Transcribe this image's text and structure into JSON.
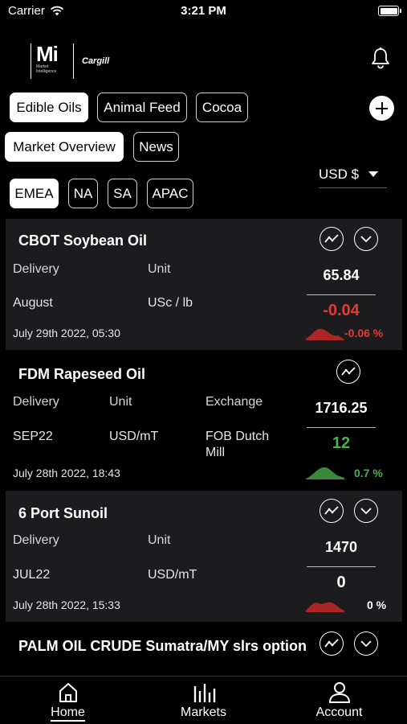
{
  "status_bar": {
    "carrier": "Carrier",
    "time": "3:21 PM"
  },
  "brand": {
    "mi": "Mi",
    "mi_sub_1": "Market",
    "mi_sub_2": "Intelligence",
    "partner": "Cargill"
  },
  "categories": [
    "Edible Oils",
    "Animal Feed",
    "Cocoa"
  ],
  "views": [
    "Market Overview",
    "News"
  ],
  "regions": [
    "EMEA",
    "NA",
    "SA",
    "APAC"
  ],
  "currency": "USD $",
  "products": [
    {
      "name": "CBOT Soybean Oil",
      "delivery_label": "Delivery",
      "unit_label": "Unit",
      "delivery": "August",
      "unit": "USc / lb",
      "date": "July 29th 2022, 05:30",
      "price": "65.84",
      "change": "-0.04",
      "change_pct": "-0.06 %"
    },
    {
      "name": "FDM Rapeseed Oil",
      "delivery_label": "Delivery",
      "unit_label": "Unit",
      "exchange_label": "Exchange",
      "delivery": "SEP22",
      "unit": "USD/mT",
      "exchange": "FOB Dutch Mill",
      "date": "July 28th 2022, 18:43",
      "price": "1716.25",
      "change": "12",
      "change_pct": "0.7 %"
    },
    {
      "name": "6 Port Sunoil",
      "delivery_label": "Delivery",
      "unit_label": "Unit",
      "delivery": "JUL22",
      "unit": "USD/mT",
      "date": "July 28th 2022, 15:33",
      "price": "1470",
      "change": "0",
      "change_pct": "0 %"
    },
    {
      "name": "PALM OIL CRUDE Sumatra/MY slrs option"
    }
  ],
  "tabs": [
    {
      "label": "Home",
      "icon": "home-icon"
    },
    {
      "label": "Markets",
      "icon": "bar-chart-icon"
    },
    {
      "label": "Account",
      "icon": "user-icon"
    }
  ],
  "colors": {
    "negative": "#e53935",
    "positive": "#4caf50",
    "card_bg": "#1c1c1e",
    "underline": "#2e7d32"
  }
}
